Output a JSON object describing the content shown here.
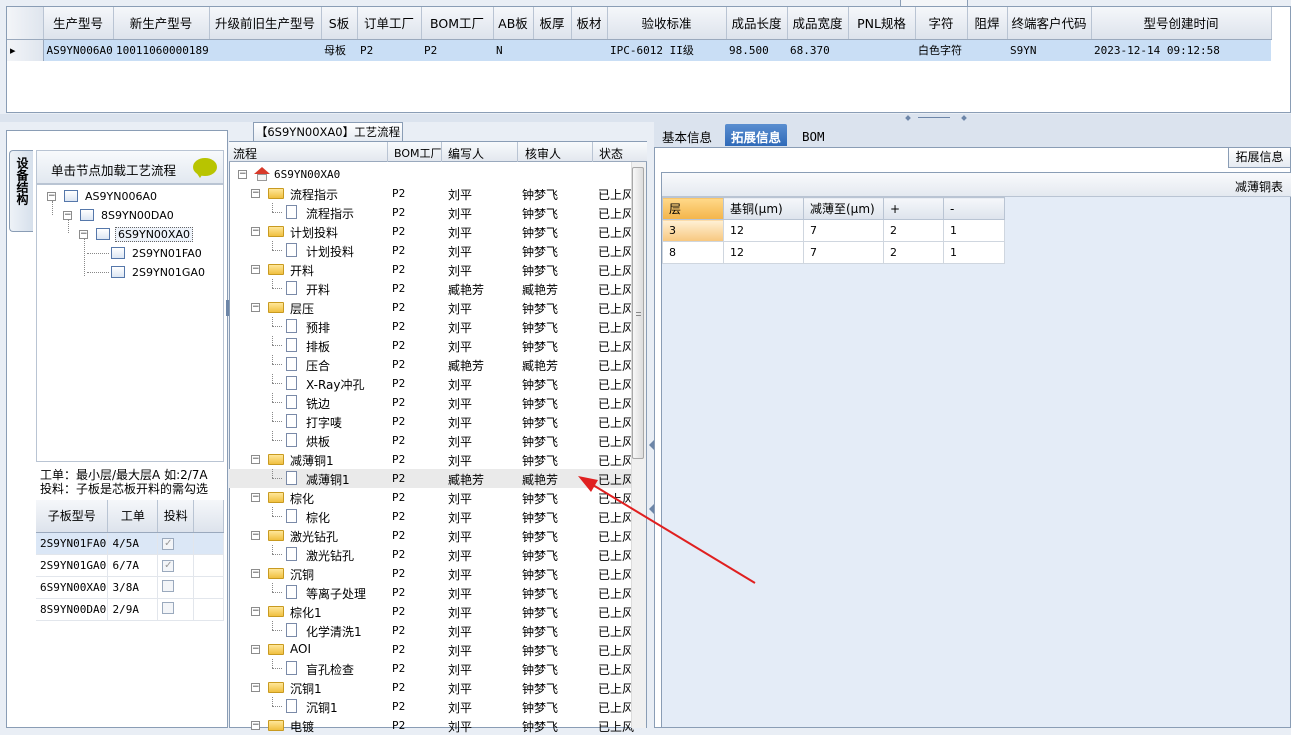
{
  "top_grid": {
    "columns": [
      "生产型号",
      "新生产型号",
      "升级前旧生产型号",
      "S板",
      "订单工厂",
      "BOM工厂",
      "AB板",
      "板厚",
      "板材",
      "验收标准",
      "成品长度",
      "成品宽度",
      "PNL规格",
      "字符",
      "阻焊",
      "终端客户代码",
      "型号创建时间"
    ],
    "row": [
      "AS9YN006A0",
      "10011060000189",
      "",
      "母板",
      "P2",
      "P2",
      "N",
      "",
      "",
      "IPC-6012 II级",
      "98.500",
      "68.370",
      "",
      "白色字符",
      "",
      "S9YN",
      "2023-12-14 09:12:58"
    ]
  },
  "left": {
    "side_tab": "设备结构",
    "load_hint": "单击节点加载工艺流程",
    "tree": [
      "AS9YN006A0",
      "8S9YN00DA0",
      "6S9YN00XA0",
      "2S9YN01FA0",
      "2S9YN01GA0"
    ],
    "notes": [
      "工单：最小层/最大层A 如:2/7A",
      "投料：子板是芯板开料的需勾选"
    ],
    "sub_columns": [
      "子板型号",
      "工单",
      "投料"
    ],
    "sub_rows": [
      {
        "model": "2S9YN01FA0",
        "ticket": "4/5A",
        "checked": true
      },
      {
        "model": "2S9YN01GA0",
        "ticket": "6/7A",
        "checked": true
      },
      {
        "model": "6S9YN00XA0",
        "ticket": "3/8A",
        "checked": false
      },
      {
        "model": "8S9YN00DA0",
        "ticket": "2/9A",
        "checked": false
      }
    ]
  },
  "middle": {
    "title": "【6S9YN00XA0】工艺流程",
    "columns": [
      "流程",
      "BOM工厂",
      "编写人",
      "核审人",
      "状态"
    ],
    "root": "6S9YN00XA0",
    "rows": [
      {
        "name": "流程指示",
        "level": 1,
        "bom": "P2",
        "writer": "刘平",
        "checker": "钟梦飞",
        "status": "已上风"
      },
      {
        "name": "流程指示",
        "level": 2,
        "bom": "P2",
        "writer": "刘平",
        "checker": "钟梦飞",
        "status": "已上风"
      },
      {
        "name": "计划投料",
        "level": 1,
        "bom": "P2",
        "writer": "刘平",
        "checker": "钟梦飞",
        "status": "已上风"
      },
      {
        "name": "计划投料",
        "level": 2,
        "bom": "P2",
        "writer": "刘平",
        "checker": "钟梦飞",
        "status": "已上风"
      },
      {
        "name": "开料",
        "level": 1,
        "bom": "P2",
        "writer": "刘平",
        "checker": "钟梦飞",
        "status": "已上风"
      },
      {
        "name": "开料",
        "level": 2,
        "bom": "P2",
        "writer": "臧艳芳",
        "checker": "臧艳芳",
        "status": "已上风"
      },
      {
        "name": "层压",
        "level": 1,
        "bom": "P2",
        "writer": "刘平",
        "checker": "钟梦飞",
        "status": "已上风"
      },
      {
        "name": "预排",
        "level": 2,
        "bom": "P2",
        "writer": "刘平",
        "checker": "钟梦飞",
        "status": "已上风"
      },
      {
        "name": "排板",
        "level": 2,
        "bom": "P2",
        "writer": "刘平",
        "checker": "钟梦飞",
        "status": "已上风"
      },
      {
        "name": "压合",
        "level": 2,
        "bom": "P2",
        "writer": "臧艳芳",
        "checker": "臧艳芳",
        "status": "已上风"
      },
      {
        "name": "X-Ray冲孔",
        "level": 2,
        "bom": "P2",
        "writer": "刘平",
        "checker": "钟梦飞",
        "status": "已上风"
      },
      {
        "name": "铣边",
        "level": 2,
        "bom": "P2",
        "writer": "刘平",
        "checker": "钟梦飞",
        "status": "已上风"
      },
      {
        "name": "打字唛",
        "level": 2,
        "bom": "P2",
        "writer": "刘平",
        "checker": "钟梦飞",
        "status": "已上风"
      },
      {
        "name": "烘板",
        "level": 2,
        "bom": "P2",
        "writer": "刘平",
        "checker": "钟梦飞",
        "status": "已上风"
      },
      {
        "name": "减薄铜1",
        "level": 1,
        "bom": "P2",
        "writer": "刘平",
        "checker": "钟梦飞",
        "status": "已上风"
      },
      {
        "name": "减薄铜1",
        "level": 2,
        "bom": "P2",
        "writer": "臧艳芳",
        "checker": "臧艳芳",
        "status": "已上风"
      },
      {
        "name": "棕化",
        "level": 1,
        "bom": "P2",
        "writer": "刘平",
        "checker": "钟梦飞",
        "status": "已上风"
      },
      {
        "name": "棕化",
        "level": 2,
        "bom": "P2",
        "writer": "刘平",
        "checker": "钟梦飞",
        "status": "已上风"
      },
      {
        "name": "激光钻孔",
        "level": 1,
        "bom": "P2",
        "writer": "刘平",
        "checker": "钟梦飞",
        "status": "已上风"
      },
      {
        "name": "激光钻孔",
        "level": 2,
        "bom": "P2",
        "writer": "刘平",
        "checker": "钟梦飞",
        "status": "已上风"
      },
      {
        "name": "沉铜",
        "level": 1,
        "bom": "P2",
        "writer": "刘平",
        "checker": "钟梦飞",
        "status": "已上风"
      },
      {
        "name": "等离子处理",
        "level": 2,
        "bom": "P2",
        "writer": "刘平",
        "checker": "钟梦飞",
        "status": "已上风"
      },
      {
        "name": "棕化1",
        "level": 1,
        "bom": "P2",
        "writer": "刘平",
        "checker": "钟梦飞",
        "status": "已上风"
      },
      {
        "name": "化学清洗1",
        "level": 2,
        "bom": "P2",
        "writer": "刘平",
        "checker": "钟梦飞",
        "status": "已上风"
      },
      {
        "name": "AOI",
        "level": 1,
        "bom": "P2",
        "writer": "刘平",
        "checker": "钟梦飞",
        "status": "已上风"
      },
      {
        "name": "盲孔检查",
        "level": 2,
        "bom": "P2",
        "writer": "刘平",
        "checker": "钟梦飞",
        "status": "已上风"
      },
      {
        "name": "沉铜1",
        "level": 1,
        "bom": "P2",
        "writer": "刘平",
        "checker": "钟梦飞",
        "status": "已上风"
      },
      {
        "name": "沉铜1",
        "level": 2,
        "bom": "P2",
        "writer": "刘平",
        "checker": "钟梦飞",
        "status": "已上风"
      },
      {
        "name": "电镀",
        "level": 1,
        "bom": "P2",
        "writer": "刘平",
        "checker": "钟梦飞",
        "status": "已上风"
      }
    ],
    "highlighted_row": 15
  },
  "right": {
    "tabs": [
      "基本信息",
      "拓展信息",
      "BOM"
    ],
    "active_tab": 1,
    "sub_label": "拓展信息",
    "table_title": "减薄铜表",
    "columns": [
      "层",
      "基铜(μm)",
      "减薄至(μm)",
      "+",
      "-"
    ],
    "rows": [
      [
        "3",
        "12",
        "7",
        "2",
        "1"
      ],
      [
        "8",
        "12",
        "7",
        "2",
        "1"
      ]
    ]
  },
  "colors": {
    "accent": "#2f6ab8",
    "selection": "#c9def5",
    "arrow": "#e02020",
    "folder": "#f0c040"
  }
}
